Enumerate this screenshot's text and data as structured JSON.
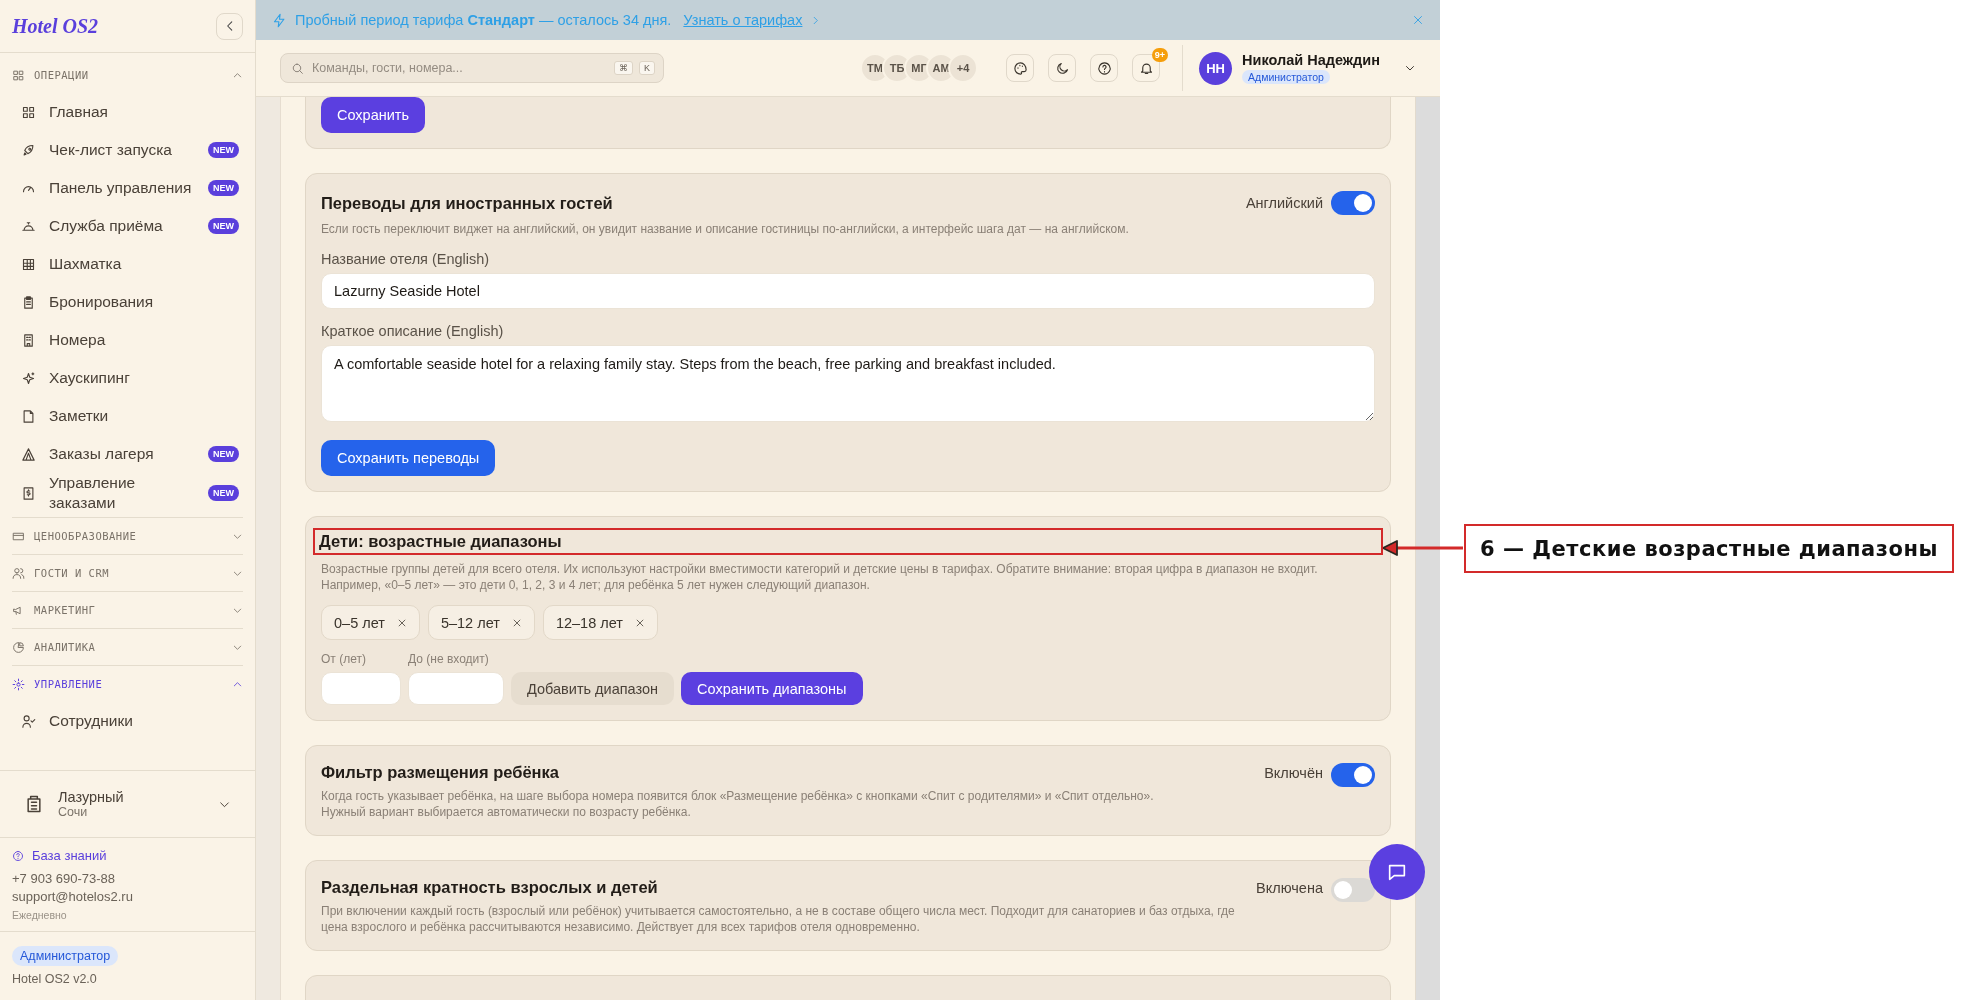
{
  "sidebar": {
    "logo": "Hotel OS2",
    "sections": [
      {
        "title": "ОПЕРАЦИИ",
        "expanded": true,
        "active": false,
        "items": [
          {
            "label": "Главная"
          },
          {
            "label": "Чек-лист запуска",
            "badge": "NEW"
          },
          {
            "label": "Панель управления",
            "badge": "NEW"
          },
          {
            "label": "Служба приёма",
            "badge": "NEW"
          },
          {
            "label": "Шахматка"
          },
          {
            "label": "Бронирования"
          },
          {
            "label": "Номера"
          },
          {
            "label": "Хаускипинг"
          },
          {
            "label": "Заметки"
          },
          {
            "label": "Заказы лагеря",
            "badge": "NEW"
          },
          {
            "label": "Управление заказами",
            "badge": "NEW"
          }
        ]
      },
      {
        "title": "ЦЕНООБРАЗОВАНИЕ",
        "expanded": false,
        "active": false
      },
      {
        "title": "ГОСТИ И CRM",
        "expanded": false,
        "active": false
      },
      {
        "title": "МАРКЕТИНГ",
        "expanded": false,
        "active": false
      },
      {
        "title": "АНАЛИТИКА",
        "expanded": false,
        "active": false
      },
      {
        "title": "УПРАВЛЕНИЕ",
        "expanded": true,
        "active": true,
        "items": [
          {
            "label": "Сотрудники"
          }
        ]
      }
    ],
    "property": {
      "name": "Лазурный",
      "city": "Сочи"
    },
    "support": {
      "link": "База знаний",
      "phone": "+7 903 690-73-88",
      "email": "support@hotelos2.ru",
      "hours": "Ежедневно"
    },
    "role": "Администратор",
    "version": "Hotel OS2 v2.0"
  },
  "banner": {
    "text": "Пробный период тарифа **Стандарт** — осталось 34 дня.",
    "link": "Узнать о тарифах"
  },
  "topbar": {
    "search": {
      "placeholder": "Команды, гости, номера..."
    },
    "shortcut": [
      "⌘",
      "K"
    ],
    "presence": [
      "ТМ",
      "ТБ",
      "МГ",
      "АМ",
      "+4"
    ],
    "notifications": "9+",
    "user": {
      "initials": "НН",
      "name": "Николай Надеждин",
      "role": "Администратор"
    }
  },
  "cards": [
    {
      "kind": "save",
      "button": {
        "label": "Сохранить"
      }
    },
    {
      "kind": "translations",
      "title": "Переводы для иностранных гостей",
      "description": "Если гость переключит виджет на английский, он увидит название и описание гостиницы по-английски, а интерфейс шага дат — на английском.",
      "toggle": {
        "label": "Английский",
        "on": true
      },
      "fields": [
        {
          "kind": "text",
          "label": "Название отеля (English)",
          "value": "Lazurny Seaside Hotel"
        },
        {
          "kind": "textarea",
          "label": "Краткое описание (English)",
          "value": "A comfortable seaside hotel for a relaxing family stay. Steps from the beach, free parking and breakfast included."
        }
      ],
      "button": {
        "label": "Сохранить переводы"
      }
    },
    {
      "kind": "ranges",
      "highlighted": true,
      "title": "Дети: возрастные диапазоны",
      "description": "Возрастные группы детей для всего отеля. Их используют настройки вместимости категорий и детские цены в тарифах. Обратите внимание: вторая цифра в диапазон не входит. Например, «0–5 лет» — это дети 0, 1, 2, 3 и 4 лет; для ребёнка 5 лет нужен следующий диапазон.",
      "chips": [
        "0–5 лет",
        "5–12 лет",
        "12–18 лет"
      ],
      "inputs": [
        {
          "label": "От (лет)"
        },
        {
          "label": "До (не входит)"
        }
      ],
      "buttons": [
        {
          "label": "Добавить диапазон"
        },
        {
          "label": "Сохранить диапазоны"
        }
      ]
    },
    {
      "kind": "toggle",
      "title": "Фильтр размещения ребёнка",
      "description": "Когда гость указывает ребёнка, на шаге выбора номера появится блок «Размещение ребёнка» с кнопками «Спит с родителями» и «Спит отдельно».\nНужный вариант выбирается автоматически по возрасту ребёнка.",
      "toggle": {
        "label": "Включён",
        "on": true
      }
    },
    {
      "kind": "toggle",
      "title": "Раздельная кратность взрослых и детей",
      "description": "При включении каждый гость (взрослый или ребёнок) учитывается самостоятельно, а не в составе общего числа мест. Подходит для санаториев и баз отдыха, где цена взрослого и ребёнка рассчитываются независимо. Действует для всех тарифов отеля одновременно.",
      "toggle": {
        "label": "Включена",
        "on": false
      }
    },
    {
      "kind": "empty"
    }
  ],
  "annotation": {
    "label": "6 — Детские возрастные диапазоны"
  }
}
